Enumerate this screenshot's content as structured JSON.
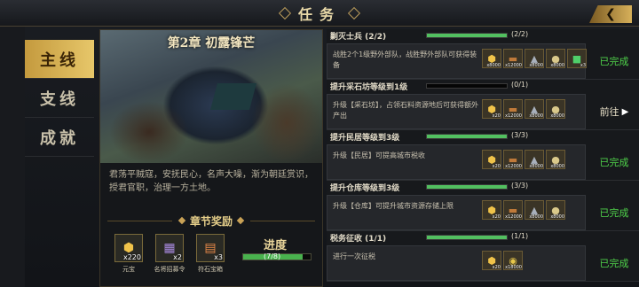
{
  "title": "任务",
  "sidebar": {
    "tabs": [
      {
        "label": "主线",
        "active": true
      },
      {
        "label": "支线",
        "active": false
      },
      {
        "label": "成就",
        "active": false
      }
    ]
  },
  "chapter": {
    "title": "第2章 初露锋芒",
    "description": "君荡平贼寇，安抚民心，名声大噪，渐为朝廷赏识，授君官职，治理一方土地。",
    "reward_heading": "章节奖励",
    "rewards": [
      {
        "icon": "ingot-icon",
        "count": "x220",
        "name": "元宝"
      },
      {
        "icon": "token-icon",
        "count": "x2",
        "name": "名将招募令"
      },
      {
        "icon": "chest-icon",
        "count": "x3",
        "name": "符石宝箱"
      }
    ],
    "progress_label": "进度",
    "progress_text": "(7/8)",
    "progress": 0.875
  },
  "tasks": [
    {
      "name": "剿灭士兵 (2/2)",
      "progress": 1.0,
      "count": "(2/2)",
      "desc": "战胜2个1级野外部队，战胜野外部队可获得装备",
      "rewards": [
        {
          "icon": "ingot-icon",
          "c": "x8000"
        },
        {
          "icon": "wood-icon",
          "c": "x12000"
        },
        {
          "icon": "iron-icon",
          "c": "x8000"
        },
        {
          "icon": "food-icon",
          "c": "x8000"
        },
        {
          "icon": "book-icon",
          "c": "x3"
        }
      ],
      "status": "已完成",
      "go": false
    },
    {
      "name": "提升采石坊等级到1级",
      "progress": 0.0,
      "count": "(0/1)",
      "desc": "升级【采石坊】，占领石料资源地后可获得额外产出",
      "rewards": [
        {
          "icon": "ingot-icon",
          "c": "x20"
        },
        {
          "icon": "wood-icon",
          "c": "x12000"
        },
        {
          "icon": "iron-icon",
          "c": "x8000"
        },
        {
          "icon": "food-icon",
          "c": "x8000"
        }
      ],
      "status": "前往",
      "go": true
    },
    {
      "name": "提升民居等级到3级",
      "progress": 1.0,
      "count": "(3/3)",
      "desc": "升级【民居】可提高城市税收",
      "rewards": [
        {
          "icon": "ingot-icon",
          "c": "x20"
        },
        {
          "icon": "wood-icon",
          "c": "x12000"
        },
        {
          "icon": "iron-icon",
          "c": "x8000"
        },
        {
          "icon": "food-icon",
          "c": "x8000"
        }
      ],
      "status": "已完成",
      "go": false
    },
    {
      "name": "提升仓库等级到3级",
      "progress": 1.0,
      "count": "(3/3)",
      "desc": "升级【仓库】可提升城市资源存储上限",
      "rewards": [
        {
          "icon": "ingot-icon",
          "c": "x20"
        },
        {
          "icon": "wood-icon",
          "c": "x12000"
        },
        {
          "icon": "iron-icon",
          "c": "x8000"
        },
        {
          "icon": "food-icon",
          "c": "x8000"
        }
      ],
      "status": "已完成",
      "go": false
    },
    {
      "name": "税务征收 (1/1)",
      "progress": 1.0,
      "count": "(1/1)",
      "desc": "进行一次征税",
      "rewards": [
        {
          "icon": "ingot-icon",
          "c": "x20"
        },
        {
          "icon": "coin-icon",
          "c": "x18000"
        }
      ],
      "status": "已完成",
      "go": false
    }
  ]
}
